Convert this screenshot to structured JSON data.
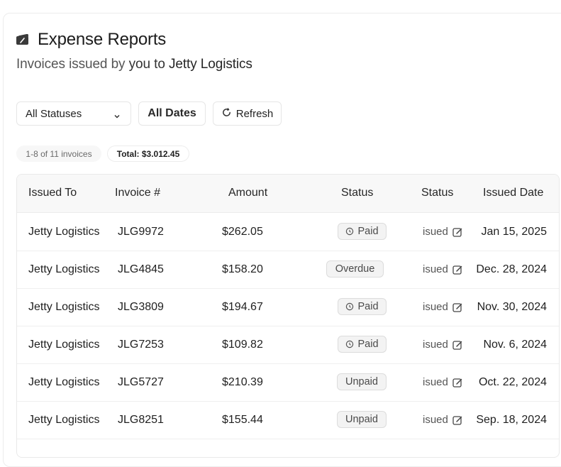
{
  "header": {
    "title": "Expense Reports",
    "subtitle_prefix": "Invoices issued by",
    "subtitle_you": "you to",
    "subtitle_client": "Jetty Logistics"
  },
  "filters": {
    "status_select": "All Statuses",
    "dates_button": "All Dates",
    "refresh_button": "Refresh"
  },
  "summary": {
    "count": "1-8 of 11 invoices",
    "total": "Total: $3.012.45"
  },
  "table": {
    "columns": [
      "Issued To",
      "Invoice #",
      "Amount",
      "Status",
      "Status",
      "Issued Date"
    ],
    "rows": [
      {
        "issued_to": "Jetty Logistics",
        "invoice": "JLG9972",
        "amount": "$262.05",
        "status": "Paid",
        "status_icon": "clock-icon",
        "issued": "isued",
        "date": "Jan 15, 2025"
      },
      {
        "issued_to": "Jetty Logistics",
        "invoice": "JLG4845",
        "amount": "$158.20",
        "status": "Overdue",
        "status_icon": "",
        "issued": "isued",
        "date": "Dec. 28, 2024"
      },
      {
        "issued_to": "Jetty Logistics",
        "invoice": "JLG3809",
        "amount": "$194.67",
        "status": "Paid",
        "status_icon": "clock-icon",
        "issued": "isued",
        "date": "Nov. 30, 2024"
      },
      {
        "issued_to": "Jetty Logistics",
        "invoice": "JLG7253",
        "amount": "$109.82",
        "status": "Paid",
        "status_icon": "clock-icon",
        "issued": "isued",
        "date": "Nov. 6, 2024"
      },
      {
        "issued_to": "Jetty Logistics",
        "invoice": "JLG5727",
        "amount": "$210.39",
        "status": "Unpaid",
        "status_icon": "",
        "issued": "isued",
        "date": "Oct. 22, 2024"
      },
      {
        "issued_to": "Jetty Logistics",
        "invoice": "JLG8251",
        "amount": "$155.44",
        "status": "Unpaid",
        "status_icon": "",
        "issued": "isued",
        "date": "Sep. 18, 2024"
      }
    ]
  },
  "icons": {
    "title": "wallet-card-icon",
    "status_select": "chevron-down-icon",
    "refresh": "refresh-icon",
    "issued": "edit-icon"
  }
}
